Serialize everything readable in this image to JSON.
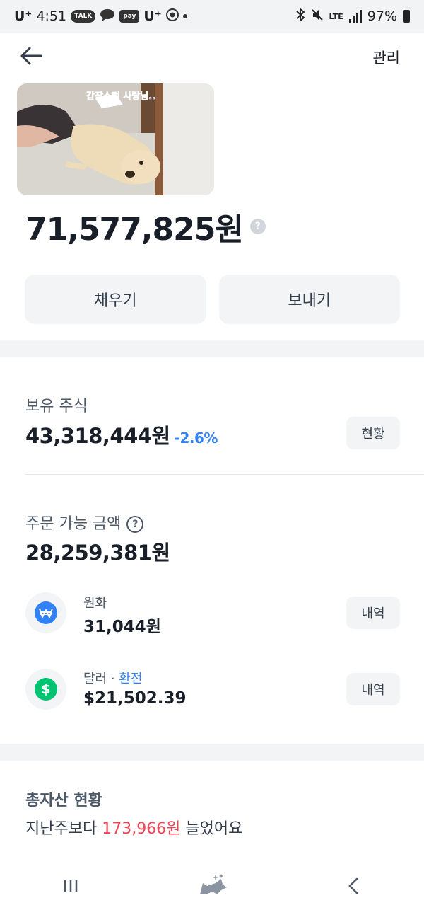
{
  "status_bar": {
    "carrier": "U⁺",
    "time": "4:51",
    "talk_badge": "TALK",
    "pay_badge": "pay",
    "carrier2": "U⁺",
    "network": "LTE",
    "battery": "97%"
  },
  "header": {
    "back_icon": "arrow-left-icon",
    "manage_label": "관리"
  },
  "banner": {
    "caption": "갑작스런 사랑님.."
  },
  "balance": {
    "amount": "71,577,825원",
    "help": "?"
  },
  "actions": {
    "fill_label": "채우기",
    "send_label": "보내기"
  },
  "stocks": {
    "label": "보유 주식",
    "amount": "43,318,444원",
    "change": "-2.6%",
    "status_button": "현황"
  },
  "orderable": {
    "label": "주문 가능 금액",
    "help": "?",
    "amount": "28,259,381원"
  },
  "currencies": [
    {
      "name": "원화",
      "amount": "31,044원",
      "button": "내역",
      "icon": "won-icon",
      "color": "#3182f6"
    },
    {
      "name": "달러",
      "separator": " · ",
      "link": "환전",
      "amount": "$21,502.39",
      "button": "내역",
      "icon": "dollar-icon",
      "color": "#00c471"
    }
  ],
  "total_assets": {
    "label": "총자산 현황",
    "prefix": "지난주보다 ",
    "change": "173,966원",
    "suffix": " 늘었어요"
  },
  "colors": {
    "accent_blue": "#3182f6",
    "increase_red": "#f04452",
    "button_bg": "#f2f4f6"
  }
}
